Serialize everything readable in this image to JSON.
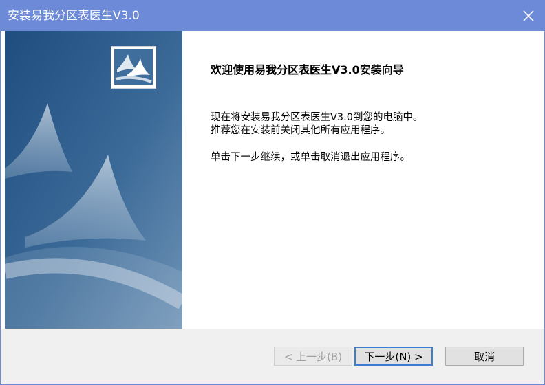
{
  "window": {
    "title": "安装易我分区表医生V3.0"
  },
  "main": {
    "heading": "欢迎使用易我分区表医生V3.0安装向导",
    "line1": "现在将安装易我分区表医生V3.0到您的电脑中。",
    "line2": "推荐您在安装前关闭其他所有应用程序。",
    "line3": "单击下一步继续，或单击取消退出应用程序。"
  },
  "buttons": {
    "back": "< 上一步(B)",
    "next": "下一步(N) >",
    "cancel": "取消"
  },
  "colors": {
    "titlebar": "#6c8ad8",
    "sidebar": "#2f5f8f",
    "focus": "#3c7fd1"
  }
}
